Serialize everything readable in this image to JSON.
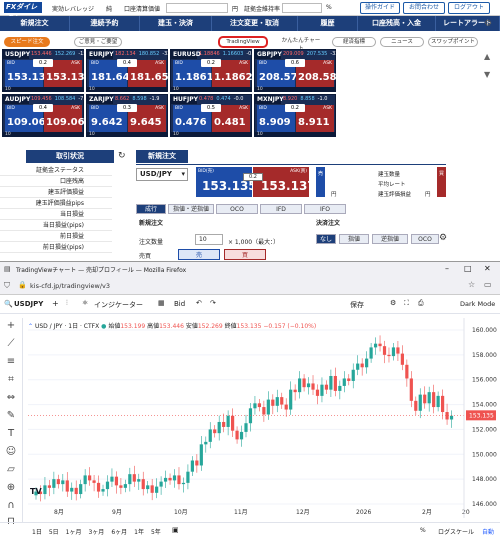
{
  "topbar": {
    "logo": "FXダイレクト",
    "items": [
      "実効レバレッジ",
      "純",
      "口座清算価値",
      "円",
      "証拠金維持率",
      "%"
    ],
    "buttons": [
      "操作ガイド",
      "お問合わせ",
      "ログアウト"
    ]
  },
  "nav": [
    "新規注文",
    "連続予約",
    "建玉・決済",
    "注文変更・取消",
    "履歴",
    "口座残高・入金",
    "レートアラート"
  ],
  "toolbar": {
    "speed": "スピード注文",
    "guide": "ご意見・ご要望",
    "tv": "TradingView",
    "chart": "かんたんチャート",
    "eco": "経済指標",
    "news": "ニュース",
    "swap": "スワップポイント"
  },
  "panels": [
    {
      "sym": "USDJPY",
      "hi": "153.446",
      "lo": "152.269",
      "chg": "-15.7",
      "bid": "153.135",
      "ask": "153.137",
      "sp": "0.2"
    },
    {
      "sym": "EURJPY",
      "hi": "182.134",
      "lo": "180.852",
      "chg": "-32.2",
      "bid": "181.648",
      "ask": "181.652",
      "sp": "0.4"
    },
    {
      "sym": "EURUSD",
      "hi": "1.18846",
      "lo": "1.16603",
      "chg": "-0.7",
      "bid": "1.18618",
      "ask": "1.18620",
      "sp": "0.2"
    },
    {
      "sym": "GBPJPY",
      "hi": "209.009",
      "lo": "207.535",
      "chg": "-32.8",
      "bid": "208.577",
      "ask": "208.583",
      "sp": "0.6"
    },
    {
      "sym": "AUDJPY",
      "hi": "109.456",
      "lo": "108.584",
      "chg": "-7.9",
      "bid": "109.062",
      "ask": "109.066",
      "sp": "0.4"
    },
    {
      "sym": "ZARJPY",
      "hi": "8.662",
      "lo": "8.598",
      "chg": "-1.9",
      "bid": "9.642",
      "ask": "9.645",
      "sp": "0.3"
    },
    {
      "sym": "HUFJPY",
      "hi": "0.478",
      "lo": "0.474",
      "chg": "-0.0",
      "bid": "0.476",
      "ask": "0.481",
      "sp": "0.5"
    },
    {
      "sym": "MXNJPY",
      "hi": "8.920",
      "lo": "8.858",
      "chg": "-1.0",
      "bid": "8.909",
      "ask": "8.911",
      "sp": "0.2"
    }
  ],
  "panel_footer": {
    "lots": "10",
    "sell": "売",
    "buy": "買"
  },
  "torihiki": {
    "title": "取引状況",
    "rows": [
      "証拠金ステータス",
      "口座残高",
      "建玉評価損益",
      "建玉評価損益pips",
      "当日損益",
      "当日損益(pips)",
      "前日損益",
      "前日損益(pips)"
    ]
  },
  "order": {
    "title": "新規注文",
    "symbol": "USD/JPY",
    "bid_label": "BID(売)",
    "ask_label": "ASK(買)",
    "bid": "153.135",
    "ask": "153.137",
    "spread": "0.2",
    "sell_lbl": "売",
    "buy_lbl": "買",
    "tabs": [
      "成行",
      "指値・逆指値",
      "OCO",
      "IFD",
      "IFO"
    ],
    "sec_label": "新規注文",
    "qty_label": "注文数量",
    "qty": "10",
    "qty_note": "× 1,000（最大：）",
    "hedge_label": "売買",
    "sell": "売",
    "buy": "買",
    "pos_labels": [
      "建玉数量",
      "平均レート",
      "建玉評価損益"
    ],
    "pos_units": [
      "",
      "",
      "円"
    ],
    "close_label": "決済注文",
    "close_tabs": [
      "なし",
      "指値",
      "逆指値",
      "OCO"
    ]
  },
  "ff": {
    "title": "TradingViewチャート — 売却プロフィール — Mozilla Firefox",
    "url": "kis-cfd.jp/tradingview/v3",
    "symbol": "USDJPY",
    "indicators": "インジケーター",
    "bid": "Bid",
    "save": "保存",
    "darkmode": "Dark Mode"
  },
  "chart_header": {
    "title": "USD / JPY · 1日 · CTFX",
    "o": "始値",
    "o_v": "153.199",
    "h": "高値",
    "h_v": "153.446",
    "l": "安値",
    "l_v": "152.269",
    "c": "終値",
    "c_v": "153.135",
    "chg": "−0.157 (−0.10%)"
  },
  "chart_data": {
    "type": "candlestick",
    "title": "USD / JPY · 1日 · CTFX",
    "ylim": [
      146,
      160
    ],
    "yticks": [
      160,
      158,
      156,
      154,
      152,
      150,
      148,
      146
    ],
    "xticks": [
      "8月",
      "9月",
      "10月",
      "11月",
      "12月",
      "2026",
      "2月",
      "20"
    ],
    "last_price": "153.135",
    "series": [
      {
        "name": "USDJPY",
        "close": [
          147.0,
          146.8,
          147.5,
          147.3,
          148.0,
          147.6,
          147.9,
          147.0,
          147.3,
          146.8,
          147.6,
          148.3,
          147.9,
          147.7,
          147.0,
          147.2,
          147.8,
          148.2,
          147.5,
          147.3,
          147.6,
          148.4,
          147.8,
          148.0,
          147.2,
          147.5,
          146.9,
          147.4,
          147.8,
          148.1,
          147.9,
          148.3,
          147.6,
          147.7,
          148.6,
          149.5,
          149.1,
          150.8,
          151.0,
          152.0,
          151.7,
          152.6,
          152.2,
          153.1,
          151.9,
          151.2,
          151.8,
          152.5,
          153.7,
          154.1,
          153.8,
          153.2,
          154.4,
          153.9,
          154.6,
          154.0,
          153.6,
          155.2,
          155.0,
          156.1,
          155.4,
          155.7,
          155.2,
          154.7,
          155.6,
          155.2,
          156.3,
          155.1,
          155.5,
          156.1,
          155.9,
          156.8,
          157.3,
          157.0,
          157.7,
          158.6,
          158.9,
          158.7,
          158.0,
          157.9,
          158.6,
          158.1,
          157.2,
          156.1,
          154.3,
          153.5,
          154.8,
          154.1,
          155.0,
          153.8,
          154.7,
          153.4,
          152.8,
          153.1
        ]
      }
    ]
  },
  "bottom": {
    "ranges": [
      "1日",
      "5日",
      "1ヶ月",
      "3ヶ月",
      "6ヶ月",
      "1年",
      "5年"
    ],
    "log": "ログスケール",
    "auto": "自動"
  },
  "colors": {
    "nav": "#1d3f7a",
    "bid": "#1e4da8",
    "ask": "#a52a2a",
    "up": "#26a69a",
    "down": "#ef5350"
  }
}
